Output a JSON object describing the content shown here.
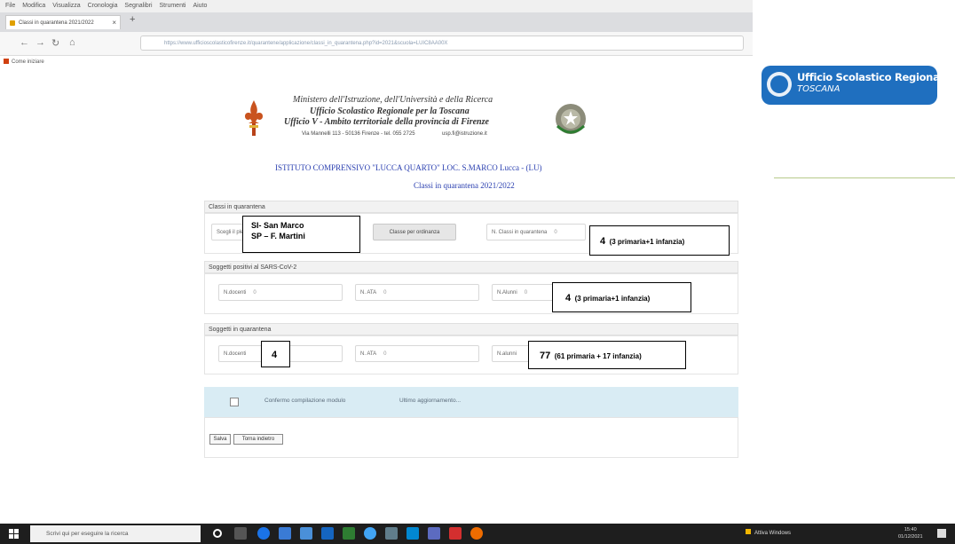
{
  "browser": {
    "menu": [
      "File",
      "Modifica",
      "Visualizza",
      "Cronologia",
      "Segnalibri",
      "Strumenti",
      "Aiuto"
    ],
    "tab_title": "Classi in quarantena 2021/2022",
    "url": "https://www.ufficioscolasticofirenze.it/quarantene/applicazione/classi_in_quarantena.php?id=2021&scuola=LUIC8AA00X",
    "bookmark": "Come iniziare"
  },
  "header": {
    "line1": "Ministero dell'Istruzione, dell'Università e della Ricerca",
    "line2": "Ufficio Scolastico Regionale per la Toscana",
    "line3": "Ufficio V - Ambito territoriale della provincia di Firenze",
    "address": "Via Mannelli 113 - 50136 Firenze - tel. 055 2725",
    "contact": "usp.fi@istruzione.it",
    "school": "ISTITUTO COMPRENSIVO \"LUCCA QUARTO\" LOC. S.MARCO Lucca - (LU)",
    "subtitle": "Classi in quarantena 2021/2022"
  },
  "section1": {
    "title": "Classi in quarantena",
    "select_placeholder": "Scegli il plesso",
    "button": "Classe per ordinanza",
    "field_label": "N. Classi in quarantena",
    "field_value": "0"
  },
  "section2": {
    "title": "Soggetti positivi al SARS-CoV-2",
    "docenti_label": "N.docenti",
    "docenti_value": "0",
    "ata_label": "N. ATA",
    "ata_value": "0",
    "alunni_label": "N.Alunni",
    "alunni_value": "0"
  },
  "section3": {
    "title": "Soggetti in quarantena",
    "docenti_label": "N.docenti",
    "ata_label": "N. ATA",
    "ata_value": "0",
    "alunni_label": "N.alunni"
  },
  "callouts": {
    "plessi_line1": "SI- San Marco",
    "plessi_line2": "SP – F. Martini",
    "classi_big": "4",
    "classi_small": "(3 primaria+1 infanzia)",
    "positivi_big": "4",
    "positivi_small": "(3 primaria+1 infanzia)",
    "docenti_big": "4",
    "alunni_big": "77",
    "alunni_small": "(61 primaria + 17 infanzia)"
  },
  "confirm": {
    "text": "Confermo compilazione modulo",
    "last_update": "Ultimo aggiornamento..."
  },
  "buttons": {
    "salva": "Salva",
    "torna": "Torna indietro"
  },
  "usr": {
    "title": "Ufficio Scolastico Regionale",
    "region": "TOSCANA"
  },
  "taskbar": {
    "search": "Scrivi qui per eseguire la ricerca",
    "tray": "Attiva Windows",
    "time": "15:40",
    "date": "01/12/2021"
  }
}
